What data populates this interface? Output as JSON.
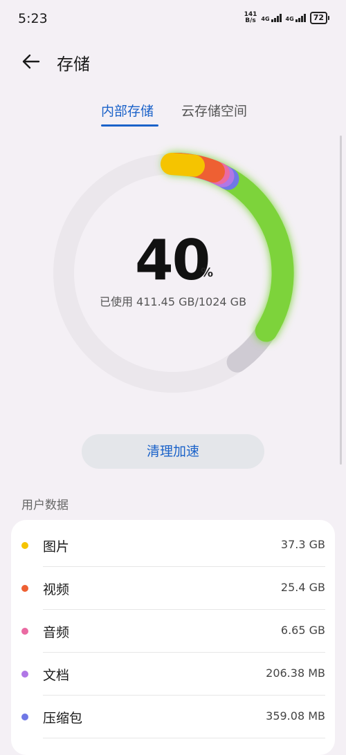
{
  "status_bar": {
    "time": "5:23",
    "net_speed_value": "141",
    "net_speed_unit": "B/s",
    "sim1_label": "4G",
    "sim2_label": "4G",
    "battery": "72"
  },
  "header": {
    "back_icon": "arrow-left-icon",
    "title": "存储"
  },
  "tabs": [
    {
      "label": "内部存储",
      "active": true
    },
    {
      "label": "云存储空间",
      "active": false
    }
  ],
  "storage": {
    "percent": "40",
    "percent_unit": "%",
    "used_text": "已使用 411.45 GB/1024 GB",
    "used_fraction": 0.4
  },
  "clean_button": {
    "label": "清理加速"
  },
  "user_data": {
    "section_title": "用户数据",
    "items": [
      {
        "name": "图片",
        "size": "37.3 GB",
        "color": "#f5c400"
      },
      {
        "name": "视频",
        "size": "25.4 GB",
        "color": "#ee6033"
      },
      {
        "name": "音频",
        "size": "6.65 GB",
        "color": "#ea6aa2"
      },
      {
        "name": "文档",
        "size": "206.38 MB",
        "color": "#b077e6"
      },
      {
        "name": "压缩包",
        "size": "359.08 MB",
        "color": "#6f78e6"
      }
    ]
  },
  "colors": {
    "accent": "#1a62c9",
    "ring_track": "#ebe7ec",
    "ring_apps": "#7dd33a",
    "ring_system": "#cfcbd3"
  }
}
